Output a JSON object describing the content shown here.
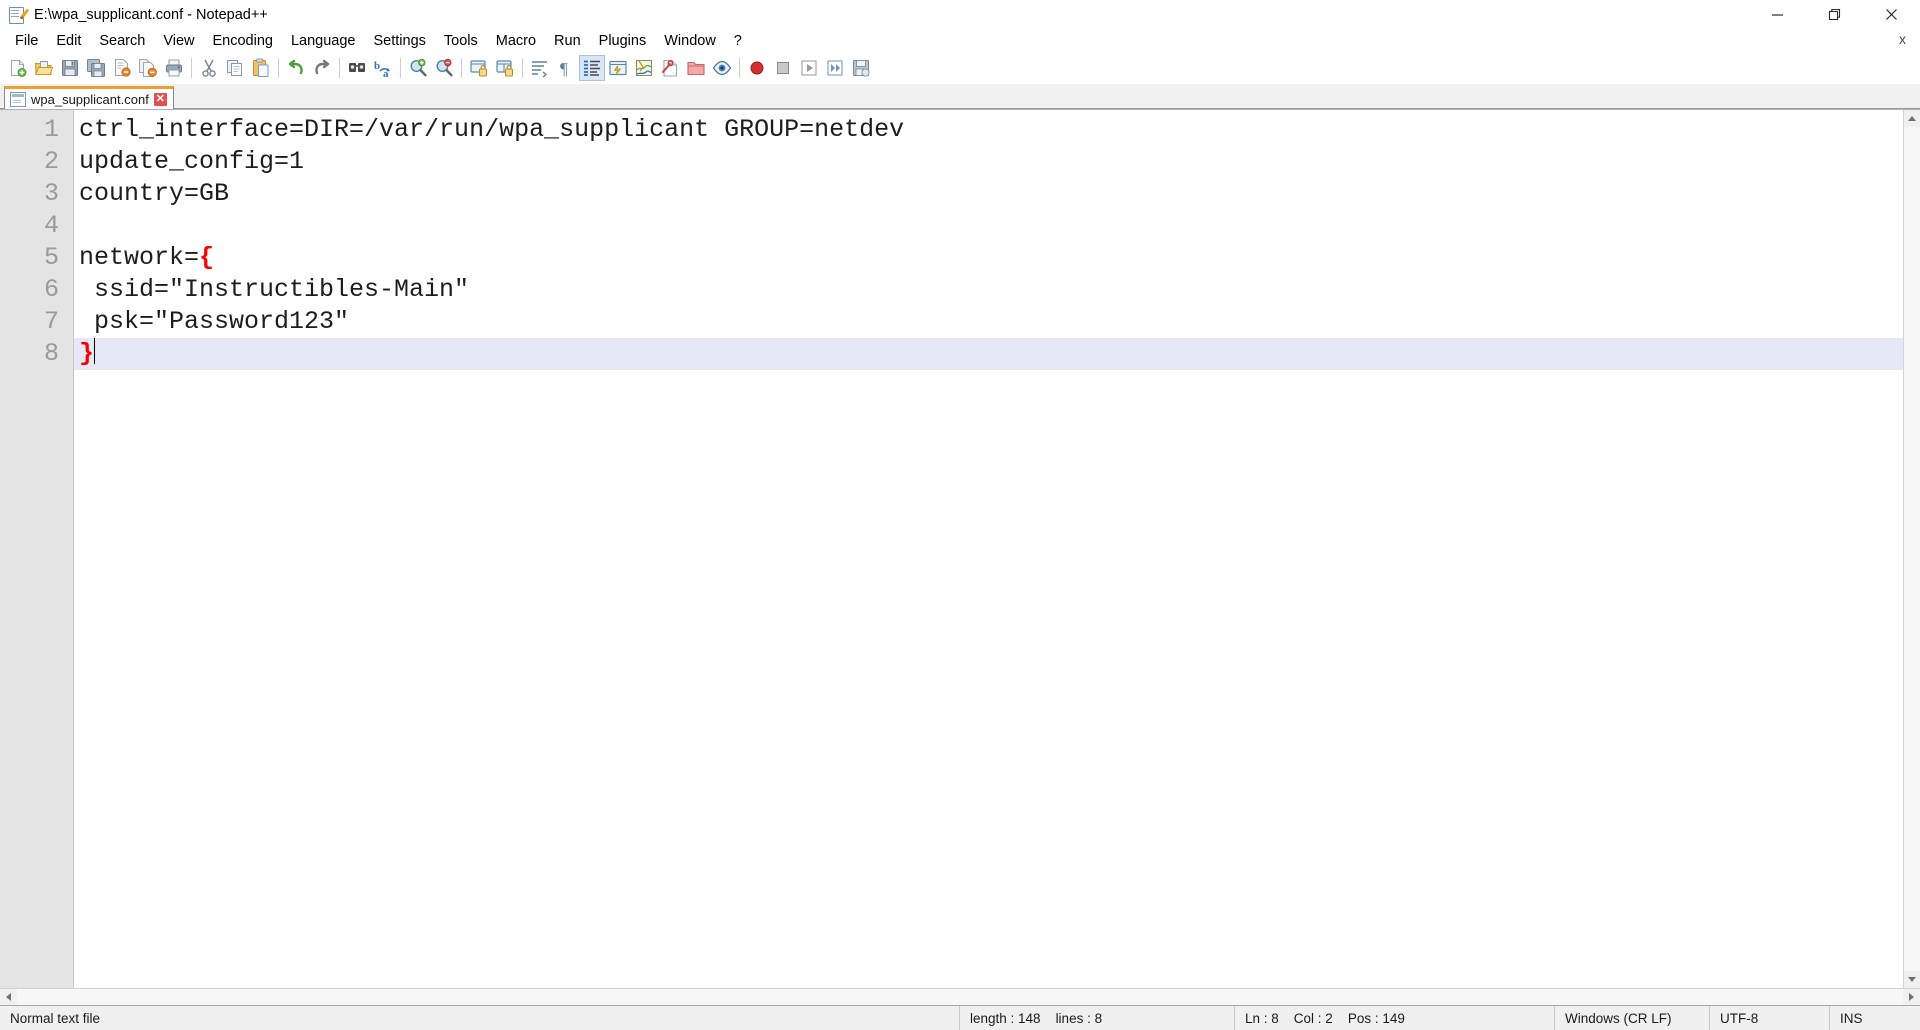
{
  "window": {
    "title": "E:\\wpa_supplicant.conf - Notepad++",
    "icon": "notepad-plus-plus-icon",
    "controls": {
      "minimize": "minimize-icon",
      "restore": "restore-icon",
      "close": "close-icon"
    }
  },
  "menu": {
    "items": [
      {
        "label": "File"
      },
      {
        "label": "Edit"
      },
      {
        "label": "Search"
      },
      {
        "label": "View"
      },
      {
        "label": "Encoding"
      },
      {
        "label": "Language"
      },
      {
        "label": "Settings"
      },
      {
        "label": "Tools"
      },
      {
        "label": "Macro"
      },
      {
        "label": "Run"
      },
      {
        "label": "Plugins"
      },
      {
        "label": "Window"
      },
      {
        "label": "?"
      }
    ],
    "close_document_label": "x"
  },
  "toolbar": {
    "buttons": [
      {
        "name": "new-file-icon",
        "title": "New"
      },
      {
        "name": "open-file-icon",
        "title": "Open"
      },
      {
        "name": "save-icon",
        "title": "Save"
      },
      {
        "name": "save-all-icon",
        "title": "Save All"
      },
      {
        "name": "close-file-icon",
        "title": "Close"
      },
      {
        "name": "close-all-files-icon",
        "title": "Close All"
      },
      {
        "name": "print-icon",
        "title": "Print"
      },
      {
        "name": "separator-1",
        "title": ""
      },
      {
        "name": "cut-icon",
        "title": "Cut"
      },
      {
        "name": "copy-icon",
        "title": "Copy"
      },
      {
        "name": "paste-icon",
        "title": "Paste"
      },
      {
        "name": "separator-2",
        "title": ""
      },
      {
        "name": "undo-icon",
        "title": "Undo"
      },
      {
        "name": "redo-icon",
        "title": "Redo"
      },
      {
        "name": "separator-3",
        "title": ""
      },
      {
        "name": "find-icon",
        "title": "Find"
      },
      {
        "name": "replace-icon",
        "title": "Replace"
      },
      {
        "name": "separator-4",
        "title": ""
      },
      {
        "name": "zoom-in-icon",
        "title": "Zoom In"
      },
      {
        "name": "zoom-out-icon",
        "title": "Zoom Out"
      },
      {
        "name": "separator-5",
        "title": ""
      },
      {
        "name": "sync-vertical-scrolling-icon",
        "title": "Synchronize Vertical Scrolling"
      },
      {
        "name": "sync-horizontal-scrolling-icon",
        "title": "Synchronize Horizontal Scrolling"
      },
      {
        "name": "word-wrap-icon",
        "title": "Word wrap"
      },
      {
        "name": "show-all-characters-icon",
        "title": "Show All Characters"
      },
      {
        "name": "indent-guide-icon",
        "title": "Show Indent Guide"
      },
      {
        "name": "user-defined-dialog-icon",
        "title": "Show UserDefine Dialog"
      },
      {
        "name": "document-map-icon",
        "title": "Document Map"
      },
      {
        "name": "function-list-icon",
        "title": "Function List"
      },
      {
        "name": "folder-as-workspace-icon",
        "title": "Folder as Workspace"
      },
      {
        "name": "monitoring-icon",
        "title": "Monitoring"
      },
      {
        "name": "separator-6",
        "title": ""
      },
      {
        "name": "record-macro-icon",
        "title": "Start Recording"
      },
      {
        "name": "stop-recording-icon",
        "title": "Stop Recording"
      },
      {
        "name": "play-macro-icon",
        "title": "Playback"
      },
      {
        "name": "run-macro-multiple-icon",
        "title": "Run a Macro Multiple Times"
      },
      {
        "name": "save-macro-icon",
        "title": "Save Current Recorded Macro"
      }
    ],
    "active_button": "word-wrap-icon"
  },
  "tabs": [
    {
      "label": "wpa_supplicant.conf",
      "icon": "document-icon",
      "close": "✕",
      "active": true
    }
  ],
  "editor": {
    "line_numbers": [
      "1",
      "2",
      "3",
      "4",
      "5",
      "6",
      "7",
      "8"
    ],
    "lines": [
      {
        "number": "1",
        "text": "ctrl_interface=DIR=/var/run/wpa_supplicant GROUP=netdev",
        "current": false
      },
      {
        "number": "2",
        "text": "update_config=1",
        "current": false
      },
      {
        "number": "3",
        "text": "country=GB",
        "current": false
      },
      {
        "number": "4",
        "text": "",
        "current": false
      },
      {
        "number": "5",
        "text": "network=",
        "brace": "{",
        "current": false
      },
      {
        "number": "6",
        "text": " ssid=\"Instructibles-Main\"",
        "current": false
      },
      {
        "number": "7",
        "text": " psk=\"Password123\"",
        "current": false
      },
      {
        "number": "8",
        "text": "",
        "brace": "}",
        "current": true
      }
    ]
  },
  "scrollbars": {
    "vertical_up": "scroll-up-arrow",
    "vertical_down": "scroll-down-arrow",
    "horizontal_left": "scroll-left-arrow",
    "horizontal_right": "scroll-right-arrow"
  },
  "statusbar": {
    "doc_type": "Normal text file",
    "length_label": "length : 148",
    "lines_label": "lines : 8",
    "ln": "Ln : 8",
    "col": "Col : 2",
    "pos": "Pos : 149",
    "eol": "Windows (CR LF)",
    "encoding": "UTF-8",
    "insert_mode": "INS"
  },
  "colors": {
    "tab_accent": "#f0a030",
    "brace_red": "#ff0000",
    "current_line": "#e6e8f8",
    "gutter_bg": "#e4e4e4",
    "statusbar_bg": "#f0f0f0"
  }
}
